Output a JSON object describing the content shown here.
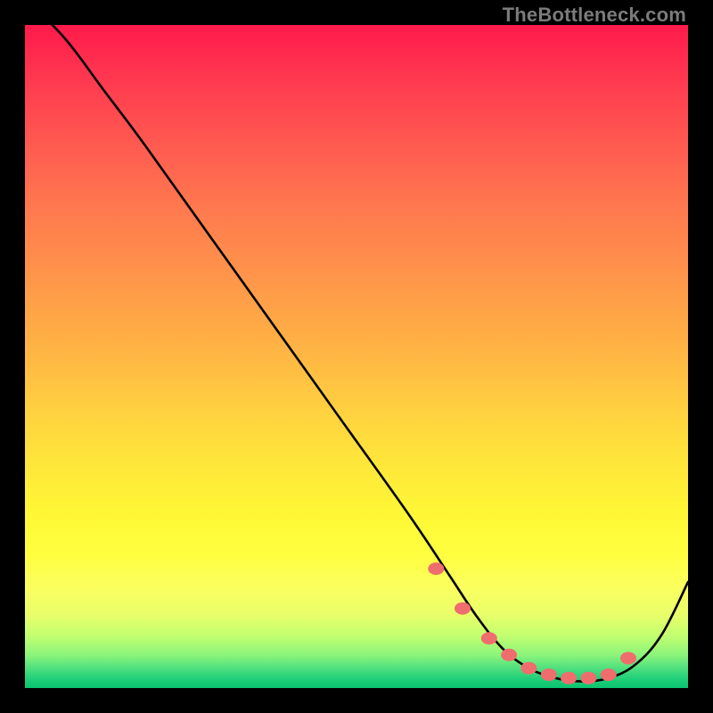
{
  "watermark": "TheBottleneck.com",
  "chart_data": {
    "type": "line",
    "title": "",
    "xlabel": "",
    "ylabel": "",
    "xlim": [
      0,
      100
    ],
    "ylim": [
      0,
      100
    ],
    "grid": false,
    "series": [
      {
        "name": "bottleneck-curve",
        "x": [
          0,
          6,
          12,
          18,
          28,
          38,
          48,
          58,
          64,
          68,
          72,
          76,
          80,
          84,
          88,
          92,
          96,
          100
        ],
        "values": [
          104,
          98,
          90,
          82,
          68,
          54,
          40,
          26,
          17,
          11,
          6,
          3,
          1.5,
          1,
          1.5,
          3.5,
          8,
          16
        ]
      }
    ],
    "markers": {
      "name": "highlight-dots",
      "x": [
        62,
        66,
        70,
        73,
        76,
        79,
        82,
        85,
        88,
        91
      ],
      "values": [
        18,
        12,
        7.5,
        5,
        3,
        2,
        1.5,
        1.5,
        2,
        4.5
      ]
    },
    "gradient_stops": [
      {
        "pct": 0,
        "color": "#ff1a4b"
      },
      {
        "pct": 18,
        "color": "#ff5a50"
      },
      {
        "pct": 38,
        "color": "#ff954a"
      },
      {
        "pct": 58,
        "color": "#ffd040"
      },
      {
        "pct": 80,
        "color": "#ffff40"
      },
      {
        "pct": 95,
        "color": "#8cf47a"
      },
      {
        "pct": 100,
        "color": "#0ac470"
      }
    ]
  }
}
